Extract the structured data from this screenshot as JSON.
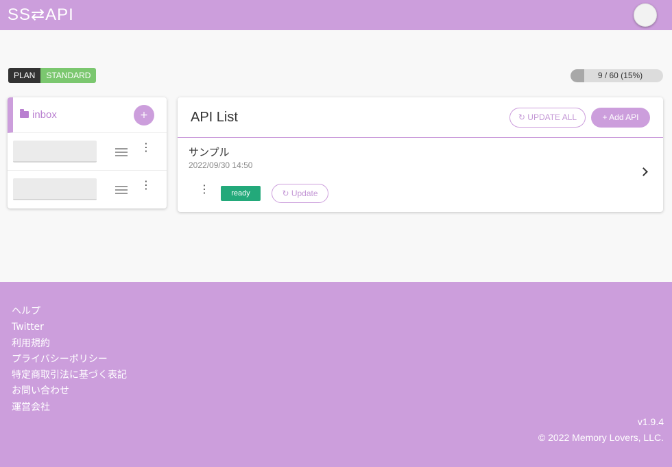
{
  "header": {
    "logo": "SS⇄API",
    "avatar_icon": "user-avatar-icon"
  },
  "plan": {
    "label": "PLAN",
    "value": "STANDARD"
  },
  "usage": {
    "text": "9 / 60 (15%)",
    "fraction": 0.15
  },
  "folders": {
    "active": {
      "name": "inbox",
      "icon": "folder-icon",
      "add_label": "+"
    },
    "row_menu": "⋮"
  },
  "api_list": {
    "title": "API List",
    "update_all_label": "↻ UPDATE ALL",
    "add_api_label": "+ Add API",
    "items": [
      {
        "name": "サンプル",
        "date": "2022/09/30 14:50",
        "menu": "⋮",
        "status": "ready",
        "update_label": "↻ Update"
      }
    ]
  },
  "footer": {
    "links": [
      "ヘルプ",
      "Twitter",
      "利用規約",
      "プライバシーポリシー",
      "特定商取引法に基づく表記",
      "お問い合わせ",
      "運営会社"
    ],
    "version": "v1.9.4",
    "copyright": "© 2022 Memory Lovers, LLC."
  },
  "colors": {
    "brand": "#cc9edc",
    "ready": "#23a97a",
    "plan_standard": "#7bc76f"
  }
}
